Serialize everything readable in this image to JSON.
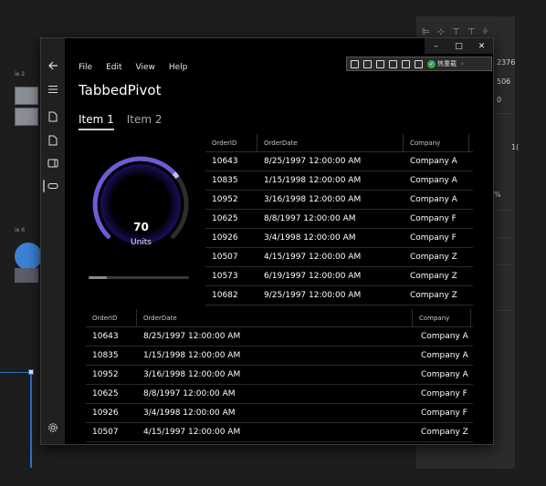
{
  "background": {
    "right_values": [
      "2376",
      "506",
      "0"
    ],
    "left_labels": [
      "ie 2",
      "ie 6"
    ],
    "side_labels": [
      "1(",
      "%"
    ]
  },
  "window": {
    "controls": {
      "minimize": "–",
      "maximize": "□",
      "close": "✕"
    },
    "debug_toolbar": {
      "badge_text": "热重载"
    }
  },
  "menu": [
    "File",
    "Edit",
    "View",
    "Help"
  ],
  "app_title": "TabbedPivot",
  "tabs": [
    {
      "label": "Item 1",
      "selected": true
    },
    {
      "label": "Item 2",
      "selected": false
    }
  ],
  "gauge": {
    "value": "70",
    "units": "Units",
    "fraction": 0.7,
    "needle_color": "#c7b9ff",
    "arc_color": "#6a5cd6"
  },
  "progress": {
    "fraction": 0.18
  },
  "grid_top": {
    "columns": [
      "OrderID",
      "OrderDate",
      "Company"
    ],
    "rows": [
      [
        "10643",
        "8/25/1997 12:00:00 AM",
        "Company A"
      ],
      [
        "10835",
        "1/15/1998 12:00:00 AM",
        "Company A"
      ],
      [
        "10952",
        "3/16/1998 12:00:00 AM",
        "Company A"
      ],
      [
        "10625",
        "8/8/1997 12:00:00 AM",
        "Company F"
      ],
      [
        "10926",
        "3/4/1998 12:00:00 AM",
        "Company F"
      ],
      [
        "10507",
        "4/15/1997 12:00:00 AM",
        "Company Z"
      ],
      [
        "10573",
        "6/19/1997 12:00:00 AM",
        "Company Z"
      ],
      [
        "10682",
        "9/25/1997 12:00:00 AM",
        "Company Z"
      ]
    ]
  },
  "grid_bottom": {
    "columns": [
      "OrderID",
      "OrderDate",
      "Company"
    ],
    "rows": [
      [
        "10643",
        "8/25/1997 12:00:00 AM",
        "Company A"
      ],
      [
        "10835",
        "1/15/1998 12:00:00 AM",
        "Company A"
      ],
      [
        "10952",
        "3/16/1998 12:00:00 AM",
        "Company A"
      ],
      [
        "10625",
        "8/8/1997 12:00:00 AM",
        "Company F"
      ],
      [
        "10926",
        "3/4/1998 12:00:00 AM",
        "Company F"
      ],
      [
        "10507",
        "4/15/1997 12:00:00 AM",
        "Company Z"
      ]
    ]
  }
}
